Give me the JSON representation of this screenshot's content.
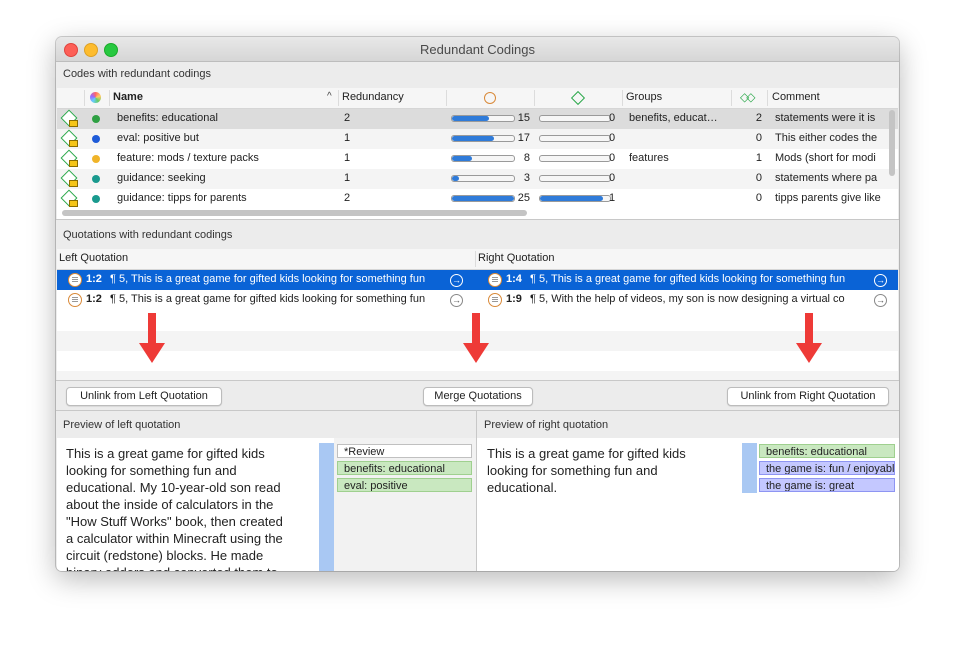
{
  "window": {
    "title": "Redundant Codings"
  },
  "codes_section": {
    "label": "Codes with redundant codings"
  },
  "codes_table": {
    "headers": {
      "name": "Name",
      "redundancy": "Redundancy",
      "groups": "Groups",
      "comment": "Comment"
    },
    "rows": [
      {
        "name": "benefits: educational",
        "redundancy": "2",
        "bar1_fraction": 0.6,
        "bar1_value": "15",
        "bar2_fraction": 0.0,
        "bar2_value": "0",
        "groups": "benefits, educat…",
        "links": "2",
        "comment": "statements were  it is",
        "dot_color": "#2ea043",
        "selected": true
      },
      {
        "name": "eval: positive but",
        "redundancy": "1",
        "bar1_fraction": 0.68,
        "bar1_value": "17",
        "bar2_fraction": 0.0,
        "bar2_value": "0",
        "groups": "",
        "links": "0",
        "comment": "This either codes the",
        "dot_color": "#1e5bd8",
        "selected": false
      },
      {
        "name": "feature: mods / texture packs",
        "redundancy": "1",
        "bar1_fraction": 0.32,
        "bar1_value": "8",
        "bar2_fraction": 0.0,
        "bar2_value": "0",
        "groups": "features",
        "links": "1",
        "comment": "Mods (short for modi",
        "dot_color": "#f0b429",
        "selected": false
      },
      {
        "name": "guidance: seeking",
        "redundancy": "1",
        "bar1_fraction": 0.12,
        "bar1_value": "3",
        "bar2_fraction": 0.0,
        "bar2_value": "0",
        "groups": "",
        "links": "0",
        "comment": "statements where pa",
        "dot_color": "#1a9a8e",
        "selected": false
      },
      {
        "name": "guidance: tipps for parents",
        "redundancy": "2",
        "bar1_fraction": 1.0,
        "bar1_value": "25",
        "bar2_fraction": 0.9,
        "bar2_value": "1",
        "groups": "",
        "links": "0",
        "comment": "tipps parents give like",
        "dot_color": "#1a9a8e",
        "selected": false
      }
    ]
  },
  "quotes_section": {
    "label": "Quotations with redundant codings"
  },
  "quotes_table": {
    "headers": {
      "left": "Left Quotation",
      "right": "Right Quotation"
    },
    "rows": [
      {
        "left_id": "1:2",
        "left_text": "¶ 5, This is a great game for gifted kids looking for something fun",
        "right_id": "1:4",
        "right_text": "¶ 5, This is a great game for gifted kids looking for something fun",
        "selected": true
      },
      {
        "left_id": "1:2",
        "left_text": "¶ 5, This is a great game for gifted kids looking for something fun",
        "right_id": "1:9",
        "right_text": "¶ 5, With the help of videos, my son is now designing a virtual co",
        "selected": false
      }
    ]
  },
  "buttons": {
    "unlink_left": "Unlink from Left Quotation",
    "merge": "Merge Quotations",
    "unlink_right": "Unlink from Right Quotation"
  },
  "left_preview": {
    "label": "Preview of left quotation",
    "lines": [
      "This is a great game for gifted kids",
      "looking for something fun and",
      "educational. My 10-year-old son read",
      "about the inside of calculators in the",
      "\"How Stuff Works\" book, then created",
      "a calculator within Minecraft using the",
      "circuit (redstone) blocks. He made",
      "binary adders and converted them to"
    ],
    "codes": [
      "*Review",
      "benefits: educational",
      "eval: positive"
    ]
  },
  "right_preview": {
    "label": "Preview of right quotation",
    "lines": [
      "This is a great game for gifted kids",
      "looking for something fun and",
      "educational."
    ],
    "codes": [
      "benefits: educational",
      "the game is: fun / enjoyable",
      "the game is: great"
    ]
  },
  "colors": {
    "selection": "#0a63d6",
    "arrow": "#ee3a37",
    "bar_fill": "#2f7bd9"
  }
}
